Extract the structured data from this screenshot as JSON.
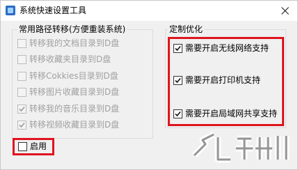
{
  "window": {
    "title": "系统快速设置工具"
  },
  "left_group": {
    "title": "常用路径转移(方便重装系统)",
    "items": [
      {
        "label": "转移我的文档目录到D盘",
        "checked": false,
        "disabled": true
      },
      {
        "label": "转移收藏夹目录到D盘",
        "checked": false,
        "disabled": true
      },
      {
        "label": "转移Cokkies目录到D盘",
        "checked": false,
        "disabled": true
      },
      {
        "label": "转移图片收藏目录到D盘",
        "checked": false,
        "disabled": true
      },
      {
        "label": "转移我的音乐目录到D盘",
        "checked": true,
        "disabled": true
      },
      {
        "label": "转移视频收藏目录到D盘",
        "checked": true,
        "disabled": true
      }
    ],
    "enable": {
      "label": "启用",
      "checked": false
    }
  },
  "right_group": {
    "title": "定制优化",
    "items": [
      {
        "label": "需要开启无线网络支持",
        "checked": true
      },
      {
        "label": "需要开启打印机支持",
        "checked": true
      },
      {
        "label": "需要开启局域网共享支持",
        "checked": true
      }
    ]
  },
  "colors": {
    "highlight": "#e0141e",
    "window_bg": "#f0f0f0",
    "disabled_text": "#a0a0a0"
  }
}
